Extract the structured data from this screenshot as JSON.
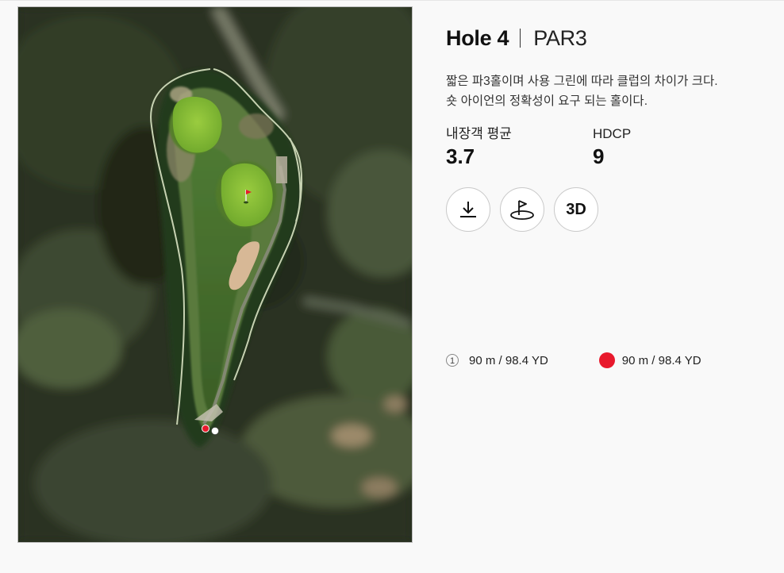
{
  "hole": {
    "title": "Hole 4",
    "par": "PAR3",
    "description": [
      "짧은 파3홀이며 사용 그린에 따라 클럽의 차이가 크다.",
      "숏 아이언의 정확성이 요구 되는 홀이다."
    ]
  },
  "stats": {
    "average_label": "내장객 평균",
    "average_value": "3.7",
    "hdcp_label": "HDCP",
    "hdcp_value": "9"
  },
  "actions": {
    "download_icon": "download-icon",
    "green_icon": "green-flag-icon",
    "view3d_label": "3D"
  },
  "distances": [
    {
      "badge": "1",
      "text": "90 m / 98.4 YD"
    },
    {
      "marker_color": "#e8192c",
      "text": "90 m / 98.4 YD"
    }
  ],
  "colors": {
    "accent_red": "#e8192c",
    "button_border": "#c9c9c9"
  }
}
